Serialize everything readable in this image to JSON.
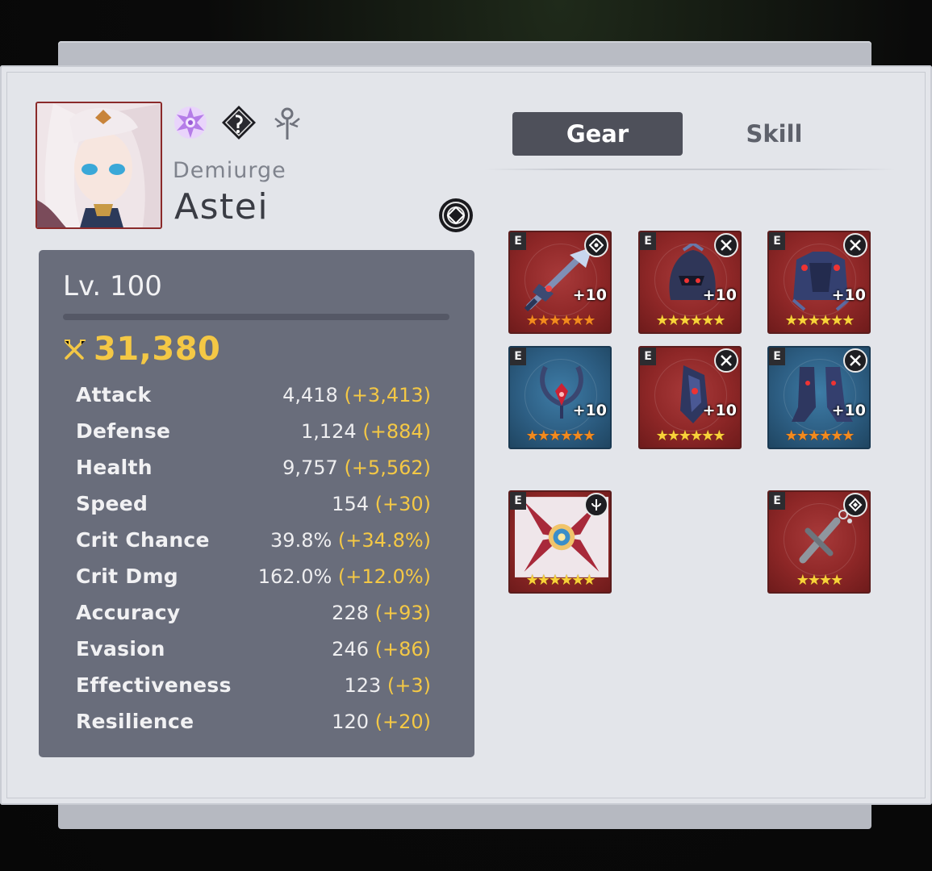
{
  "hero": {
    "class": "Demiurge",
    "name": "Astei",
    "class_icons": [
      "star-element-icon",
      "moonlight-icon",
      "soul-weaver-icon"
    ],
    "specialty_icon": "specialty-emblem-icon"
  },
  "stats_panel": {
    "level": "Lv. 100",
    "combat_power": "31,380",
    "stats": [
      {
        "name": "Attack",
        "value": "4,418",
        "bonus": "(+3,413)"
      },
      {
        "name": "Defense",
        "value": "1,124",
        "bonus": "(+884)"
      },
      {
        "name": "Health",
        "value": "9,757",
        "bonus": "(+5,562)"
      },
      {
        "name": "Speed",
        "value": "154",
        "bonus": "(+30)"
      },
      {
        "name": "Crit Chance",
        "value": "39.8%",
        "bonus": "(+34.8%)"
      },
      {
        "name": "Crit Dmg",
        "value": "162.0%",
        "bonus": "(+12.0%)"
      },
      {
        "name": "Accuracy",
        "value": "228",
        "bonus": "(+93)"
      },
      {
        "name": "Evasion",
        "value": "246",
        "bonus": "(+86)"
      },
      {
        "name": "Effectiveness",
        "value": "123",
        "bonus": "(+3)"
      },
      {
        "name": "Resilience",
        "value": "120",
        "bonus": "(+20)"
      }
    ]
  },
  "tabs": {
    "gear": "Gear",
    "skill": "Skill"
  },
  "gear": [
    {
      "slot": "weapon",
      "grade": "E",
      "enhance": "+10",
      "stars": 6,
      "color": "red",
      "set_icon": "immunity-set-icon"
    },
    {
      "slot": "helmet",
      "grade": "E",
      "enhance": "+10",
      "stars": 6,
      "color": "red",
      "set_icon": "destruction-set-icon"
    },
    {
      "slot": "armor",
      "grade": "E",
      "enhance": "+10",
      "stars": 6,
      "color": "red",
      "set_icon": "destruction-set-icon"
    },
    {
      "slot": "necklace",
      "grade": "E",
      "enhance": "+10",
      "stars": 6,
      "color": "blue",
      "set_icon": "none"
    },
    {
      "slot": "ring",
      "grade": "E",
      "enhance": "+10",
      "stars": 6,
      "color": "red",
      "set_icon": "destruction-set-icon"
    },
    {
      "slot": "boots",
      "grade": "E",
      "enhance": "+10",
      "stars": 6,
      "color": "blue",
      "set_icon": "destruction-set-icon"
    }
  ],
  "artifact": {
    "grade": "E",
    "stars": 6,
    "icon": "healer-class-icon"
  },
  "exclusive": {
    "grade": "E",
    "stars": 4,
    "icon": "exclusive-equip-icon"
  }
}
